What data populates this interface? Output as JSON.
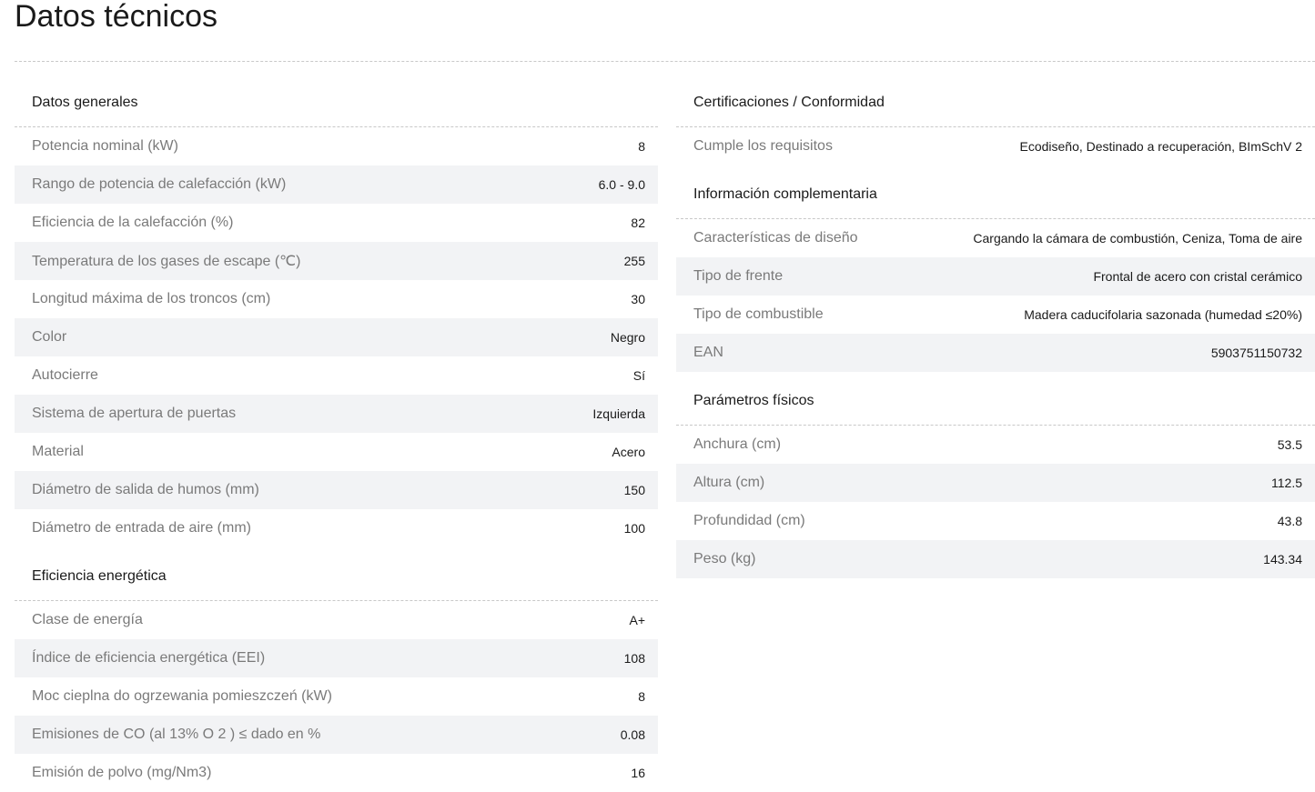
{
  "page_title": "Datos técnicos",
  "left_sections": [
    {
      "title": "Datos generales",
      "rows": [
        {
          "label": "Potencia nominal (kW)",
          "value": "8"
        },
        {
          "label": "Rango de potencia de calefacción (kW)",
          "value": "6.0 - 9.0"
        },
        {
          "label": "Eficiencia de la calefacción (%)",
          "value": "82"
        },
        {
          "label": "Temperatura de los gases de escape (℃)",
          "value": "255"
        },
        {
          "label": "Longitud máxima de los troncos (cm)",
          "value": "30"
        },
        {
          "label": "Color",
          "value": "Negro"
        },
        {
          "label": "Autocierre",
          "value": "Sí"
        },
        {
          "label": "Sistema de apertura de puertas",
          "value": "Izquierda"
        },
        {
          "label": "Material",
          "value": "Acero"
        },
        {
          "label": "Diámetro de salida de humos (mm)",
          "value": "150"
        },
        {
          "label": "Diámetro de entrada de aire (mm)",
          "value": "100"
        }
      ]
    },
    {
      "title": "Eficiencia energética",
      "rows": [
        {
          "label": "Clase de energía",
          "value": "A+"
        },
        {
          "label": "Índice de eficiencia energética (EEI)",
          "value": "108"
        },
        {
          "label": "Moc cieplna do ogrzewania pomieszczeń (kW)",
          "value": "8"
        },
        {
          "label": "Emisiones de CO (al 13% O 2 ) ≤ dado en %",
          "value": "0.08"
        },
        {
          "label": "Emisión de polvo (mg/Nm3)",
          "value": "16"
        }
      ]
    }
  ],
  "right_sections": [
    {
      "title": "Certificaciones / Conformidad",
      "rows": [
        {
          "label": "Cumple los requisitos",
          "value": "Ecodiseño, Destinado a recuperación, BImSchV 2"
        }
      ]
    },
    {
      "title": "Información complementaria",
      "rows": [
        {
          "label": "Características de diseño",
          "value": "Cargando la cámara de combustión, Ceniza, Toma de aire"
        },
        {
          "label": "Tipo de frente",
          "value": "Frontal de acero con cristal cerámico"
        },
        {
          "label": "Tipo de combustible",
          "value": "Madera caducifolaria sazonada (humedad ≤20%)"
        },
        {
          "label": "EAN",
          "value": "5903751150732"
        }
      ]
    },
    {
      "title": "Parámetros físicos",
      "rows": [
        {
          "label": "Anchura (cm)",
          "value": "53.5"
        },
        {
          "label": "Altura (cm)",
          "value": "112.5"
        },
        {
          "label": "Profundidad (cm)",
          "value": "43.8"
        },
        {
          "label": "Peso (kg)",
          "value": "143.34"
        }
      ]
    }
  ]
}
